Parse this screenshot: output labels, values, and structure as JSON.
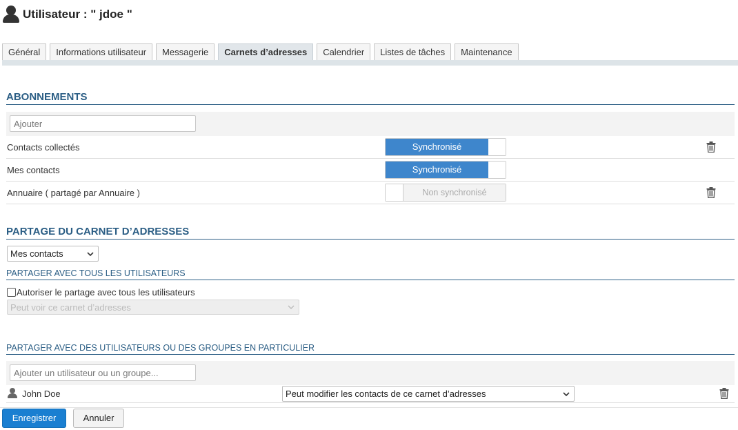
{
  "header": {
    "title": "Utilisateur : \" jdoe \""
  },
  "tabs": [
    {
      "label": "Général",
      "active": false
    },
    {
      "label": "Informations utilisateur",
      "active": false
    },
    {
      "label": "Messagerie",
      "active": false
    },
    {
      "label": "Carnets d’adresses",
      "active": true
    },
    {
      "label": "Calendrier",
      "active": false
    },
    {
      "label": "Listes de tâches",
      "active": false
    },
    {
      "label": "Maintenance",
      "active": false
    }
  ],
  "subscriptions": {
    "title": "ABONNEMENTS",
    "add_placeholder": "Ajouter",
    "items": [
      {
        "label": "Contacts collectés",
        "status": "Synchronisé",
        "synced": true,
        "deletable": true
      },
      {
        "label": "Mes contacts",
        "status": "Synchronisé",
        "synced": true,
        "deletable": false
      },
      {
        "label": "Annuaire ( partagé par Annuaire )",
        "status": "Non synchronisé",
        "synced": false,
        "deletable": true
      }
    ]
  },
  "sharing": {
    "title": "PARTAGE DU CARNET D’ADRESSES",
    "addressbook_select": "Mes contacts",
    "all_users": {
      "title": "PARTAGER AVEC TOUS LES UTILISATEURS",
      "checkbox_label": "Autoriser le partage avec tous les utilisateurs",
      "checked": false,
      "permission_select": "Peut voir ce carnet d’adresses"
    },
    "specific": {
      "title": "PARTAGER AVEC DES UTILISATEURS OU DES GROUPES EN PARTICULIER",
      "add_placeholder": "Ajouter un utilisateur ou un groupe...",
      "entries": [
        {
          "name": "John Doe",
          "permission": "Peut modifier les contacts de ce carnet d’adresses"
        }
      ]
    }
  },
  "footer": {
    "save_label": "Enregistrer",
    "cancel_label": "Annuler"
  },
  "colors": {
    "accent": "#2a5d84",
    "toggle_on": "#3e86cc",
    "primary_button": "#1a7fd1"
  }
}
